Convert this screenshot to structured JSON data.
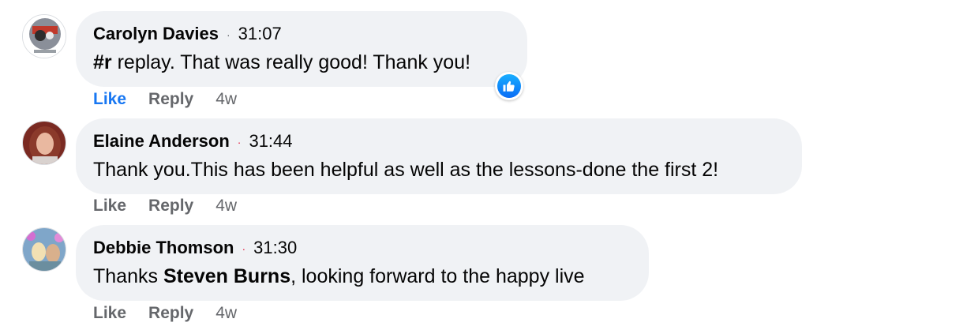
{
  "comments": [
    {
      "author": "Carolyn Davies",
      "separator": "·",
      "timestamp": "31:07",
      "text_parts": [
        {
          "text": "#r",
          "bold": true
        },
        {
          "text": " replay. That was really good! Thank you!",
          "bold": false
        }
      ],
      "actions": {
        "like": "Like",
        "reply": "Reply",
        "age": "4w"
      },
      "like_active": true,
      "reaction": "like-icon",
      "avatar": "person-avatar"
    },
    {
      "author": "Elaine Anderson",
      "separator": "·",
      "timestamp": "31:44",
      "text_parts": [
        {
          "text": "Thank you.This has been helpful as well as the lessons-done the first 2!",
          "bold": false
        }
      ],
      "actions": {
        "like": "Like",
        "reply": "Reply",
        "age": "4w"
      },
      "like_active": false,
      "avatar": "person-avatar"
    },
    {
      "author": "Debbie Thomson",
      "separator": "·",
      "timestamp": "31:30",
      "text_parts": [
        {
          "text": "Thanks ",
          "bold": false
        },
        {
          "text": "Steven Burns",
          "bold": true
        },
        {
          "text": ", looking forward to the happy live",
          "bold": false
        }
      ],
      "actions": {
        "like": "Like",
        "reply": "Reply",
        "age": "4w"
      },
      "like_active": false,
      "avatar": "person-avatar"
    }
  ],
  "colors": {
    "bubble": "#f0f2f5",
    "link_blue": "#1877f2",
    "muted": "#65676b",
    "text": "#050505",
    "new_dot": "#e41e3f"
  }
}
